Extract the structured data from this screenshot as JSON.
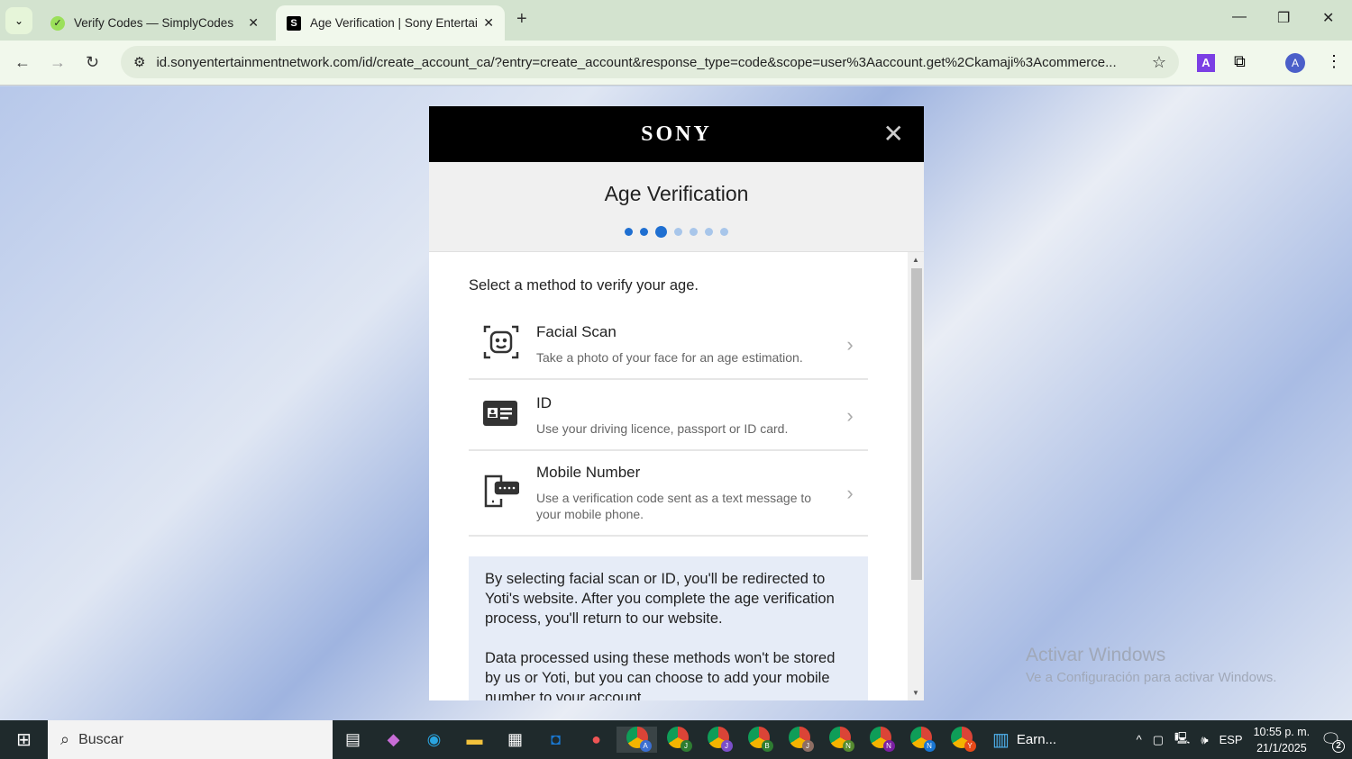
{
  "browser": {
    "tabs": [
      {
        "title": "Verify Codes — SimplyCodes",
        "active": false
      },
      {
        "title": "Age Verification | Sony Entertainment Network",
        "active": true
      }
    ],
    "url": "id.sonyentertainmentnetwork.com/id/create_account_ca/?entry=create_account&response_type=code&scope=user%3Aaccount.get%2Ckamaji%3Acommerce...",
    "profile_initial": "A"
  },
  "modal": {
    "logo": "SONY",
    "title": "Age Verification",
    "steps_total": 7,
    "current_step": 3,
    "lead": "Select a method to verify your age.",
    "options": [
      {
        "icon": "face-scan-icon",
        "title": "Facial Scan",
        "desc": "Take a photo of your face for an age estimation."
      },
      {
        "icon": "id-card-icon",
        "title": "ID",
        "desc": "Use your driving licence, passport or ID card."
      },
      {
        "icon": "mobile-sms-icon",
        "title": "Mobile Number",
        "desc": "Use a verification code sent as a text message to your mobile phone."
      }
    ],
    "info": [
      "By selecting facial scan or ID, you'll be redirected to Yoti's website. After you complete the age verification process, you'll return to our website.",
      "Data processed using these methods won't be stored by us or Yoti, but you can choose to add your mobile number to your account."
    ]
  },
  "watermark": {
    "title": "Activar Windows",
    "subtitle": "Ve a Configuración para activar Windows."
  },
  "taskbar": {
    "search_placeholder": "Buscar",
    "chrome_profiles": [
      {
        "letter": "A",
        "color": "#3b6fd1"
      },
      {
        "letter": "J",
        "color": "#2e7d32"
      },
      {
        "letter": "J",
        "color": "#7b4fc9"
      },
      {
        "letter": "B",
        "color": "#2e7d32"
      },
      {
        "letter": "J",
        "color": "#8d6e63"
      },
      {
        "letter": "N",
        "color": "#558b2f"
      },
      {
        "letter": "N",
        "color": "#7b1fa2"
      },
      {
        "letter": "N",
        "color": "#1976d2"
      },
      {
        "letter": "Y",
        "color": "#e64a19"
      }
    ],
    "open_app": "Earn...",
    "lang": "ESP",
    "time": "10:55 p. m.",
    "date": "21/1/2025",
    "notifications": "2"
  }
}
